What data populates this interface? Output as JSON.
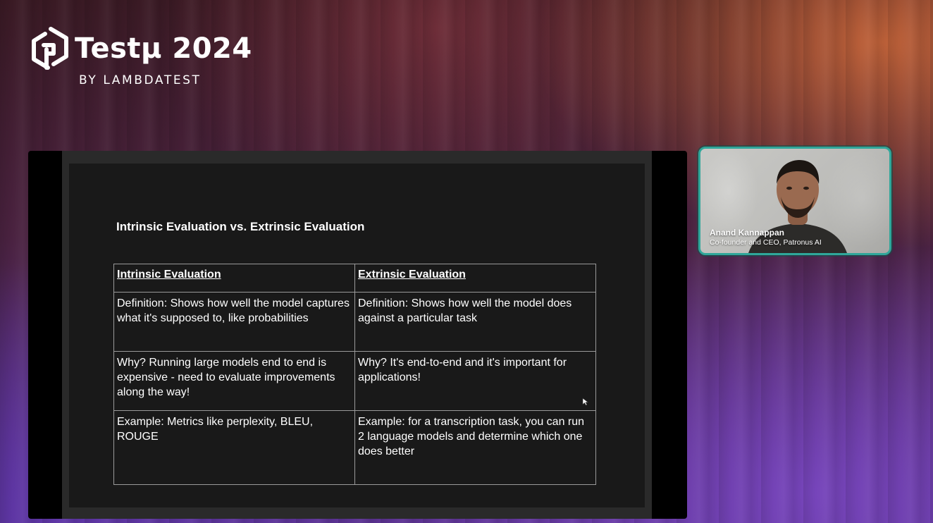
{
  "brand": {
    "name": "Testμ 2024",
    "subtitle": "BY LAMBDATEST",
    "logo_icon": "lambdatest-logo-icon"
  },
  "slide": {
    "title": "Intrinsic Evaluation vs. Extrinsic Evaluation",
    "table": {
      "headers": [
        "Intrinsic Evaluation",
        "Extrinsic Evaluation"
      ],
      "rows": [
        [
          "Definition: Shows how well the model captures what it's supposed to, like probabilities",
          "Definition: Shows how well the model does against a particular task"
        ],
        [
          "Why? Running large models end to end is expensive - need to evaluate improvements along the way!",
          "Why? It's end-to-end and it's important for applications!"
        ],
        [
          "Example: Metrics like perplexity, BLEU, ROUGE",
          "Example: for a transcription task, you can run 2 language models and determine which one does better"
        ]
      ]
    }
  },
  "presenter": {
    "name": "Anand Kannappan",
    "role": "Co-founder and CEO, Patronus AI"
  },
  "colors": {
    "webcam_border": "#2fa79a",
    "slide_background": "#191919",
    "accent_orange": "#d66e3c",
    "accent_purple": "#7846be"
  }
}
